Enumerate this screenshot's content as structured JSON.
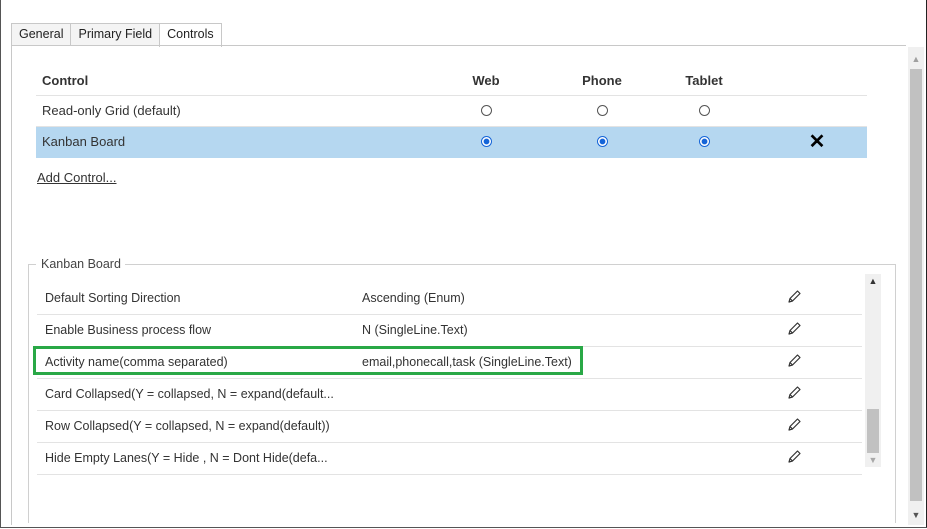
{
  "tabs": [
    "General",
    "Primary Field",
    "Controls"
  ],
  "controls_table": {
    "headers": {
      "control": "Control",
      "web": "Web",
      "phone": "Phone",
      "tablet": "Tablet"
    },
    "rows": [
      {
        "name": "Read-only Grid (default)",
        "web": false,
        "phone": false,
        "tablet": false,
        "selected": false
      },
      {
        "name": "Kanban Board",
        "web": true,
        "phone": true,
        "tablet": true,
        "selected": true
      }
    ],
    "delete_glyph": "✕",
    "add_control": "Add Control..."
  },
  "kanban": {
    "legend": "Kanban Board",
    "properties": [
      {
        "name": "Default Sorting Direction",
        "value": "Ascending (Enum)"
      },
      {
        "name": "Enable Business process flow",
        "value": "N (SingleLine.Text)"
      },
      {
        "name": "Activity name(comma separated)",
        "value": "email,phonecall,task (SingleLine.Text)",
        "highlighted": true
      },
      {
        "name": "Card Collapsed(Y = collapsed, N = expand(default...",
        "value": ""
      },
      {
        "name": "Row Collapsed(Y = collapsed, N = expand(default))",
        "value": ""
      },
      {
        "name": "Hide Empty Lanes(Y = Hide , N = Dont Hide(defa...",
        "value": ""
      }
    ]
  },
  "colors": {
    "selection": "#b5d7f0",
    "highlight_border": "#29a846",
    "radio_on": "#1565d8"
  },
  "icons": {
    "edit": "pencil-icon",
    "delete": "close-icon"
  }
}
